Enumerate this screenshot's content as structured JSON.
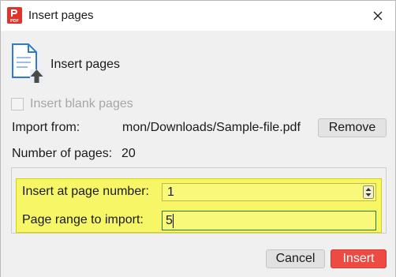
{
  "window": {
    "title": "Insert pages",
    "app_icon_label": "PDF",
    "app_icon": "pdf-app-icon",
    "close_icon": "close-icon"
  },
  "header": {
    "icon": "insert-pages-icon",
    "label": "Insert pages"
  },
  "blank_pages": {
    "label": "Insert blank pages",
    "checked": false,
    "enabled": false
  },
  "import": {
    "label": "Import from:",
    "path": "mon/Downloads/Sample-file.pdf",
    "remove_label": "Remove"
  },
  "pages": {
    "label": "Number of pages:",
    "value": "20"
  },
  "insert_at": {
    "label": "Insert at page number:",
    "value": "1"
  },
  "page_range": {
    "label": "Page range to import:",
    "value": "5"
  },
  "footer": {
    "cancel_label": "Cancel",
    "insert_label": "Insert"
  },
  "colors": {
    "accent": "#ee4a44",
    "highlight": "#f6f666",
    "dialog_bg": "#f0f0f0"
  }
}
